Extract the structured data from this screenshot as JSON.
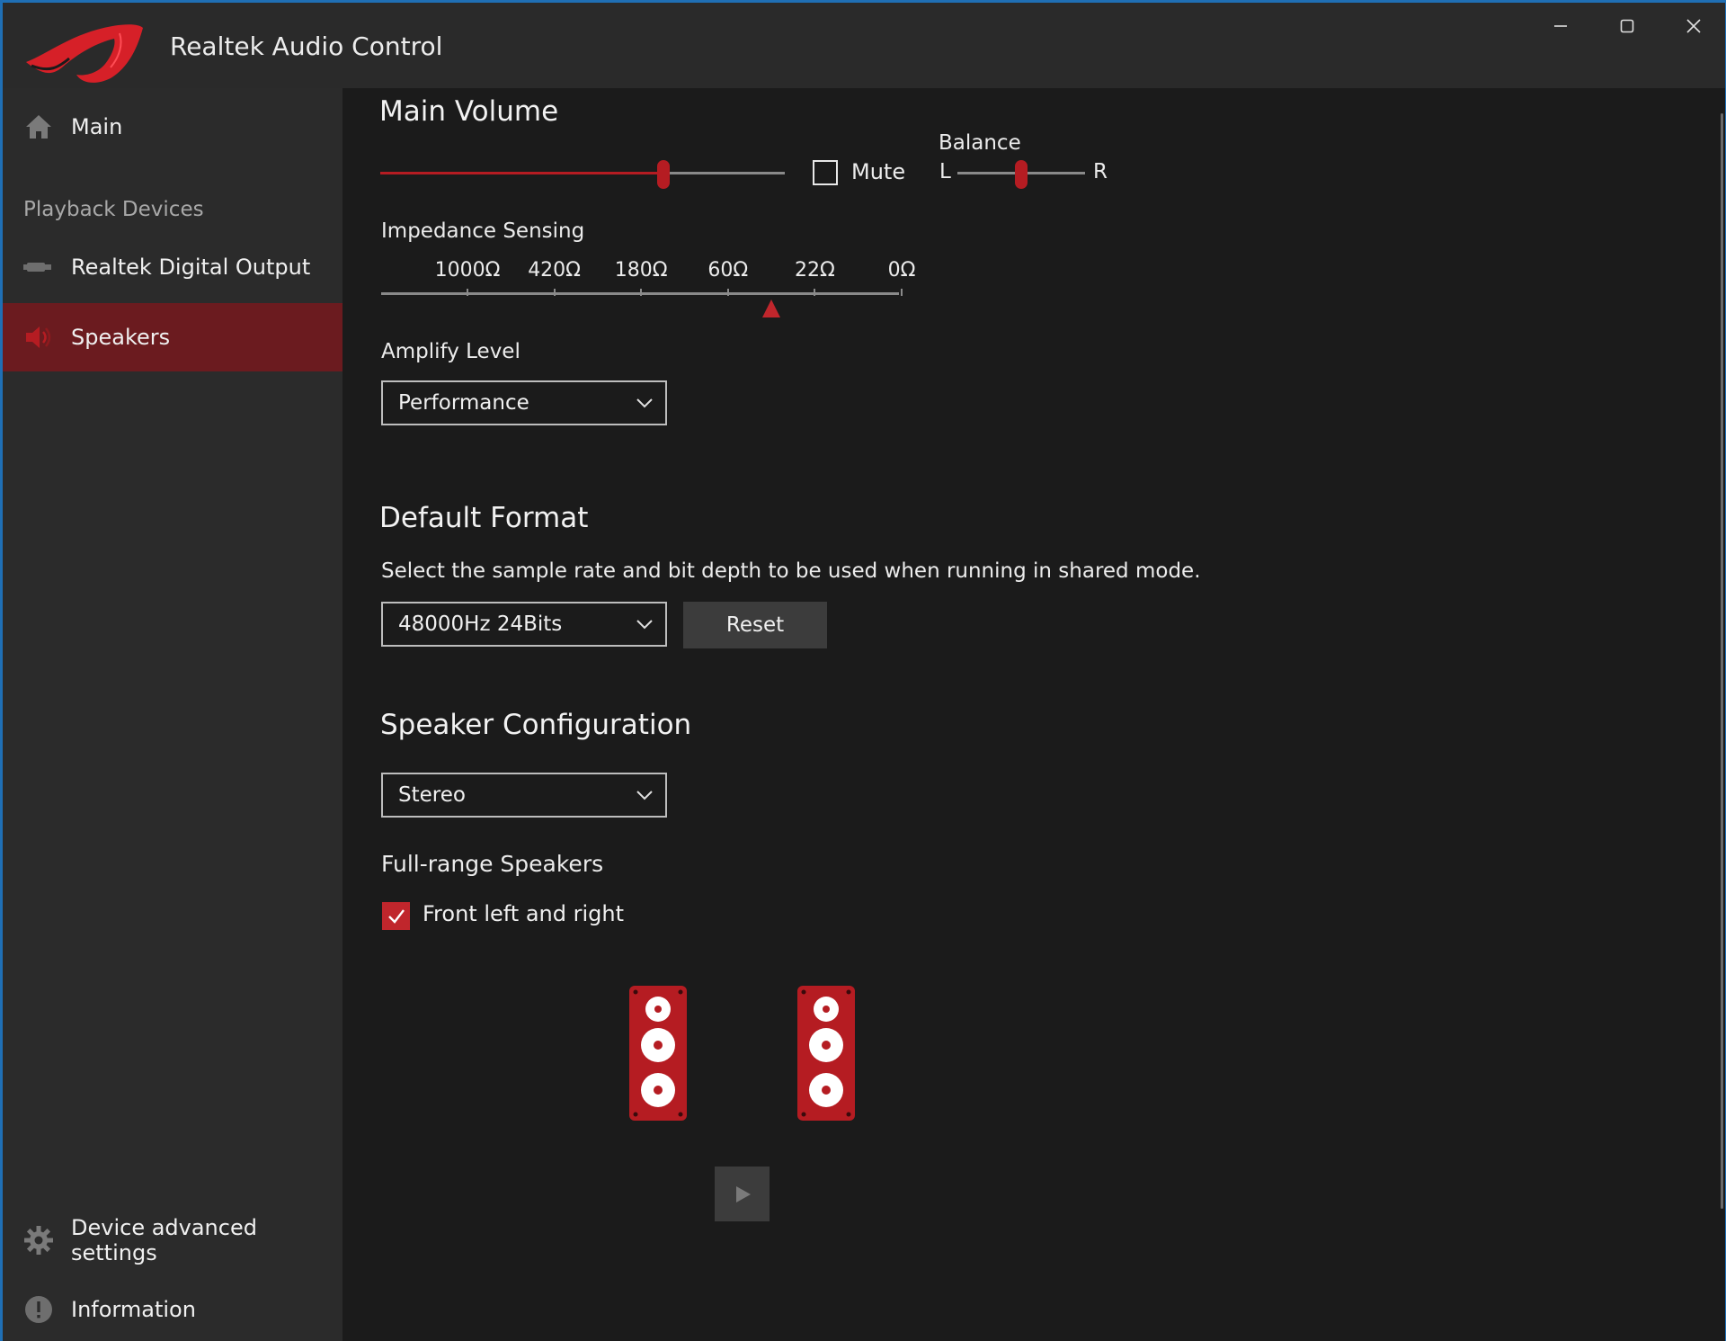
{
  "window": {
    "title": "Realtek Audio Control",
    "controls": [
      "minimize",
      "maximize",
      "close"
    ]
  },
  "sidebar": {
    "main_label": "Main",
    "section_label": "Playback Devices",
    "items": [
      {
        "label": "Realtek Digital Output",
        "icon": "digital-output-icon"
      },
      {
        "label": "Speakers",
        "icon": "speaker-icon",
        "selected": true
      }
    ],
    "advanced_label": "Device advanced settings",
    "info_label": "Information"
  },
  "main_volume": {
    "heading": "Main Volume",
    "value_fraction": 0.7,
    "mute_label": "Mute",
    "muted": false,
    "balance_label": "Balance",
    "balance_left": "L",
    "balance_right": "R",
    "balance_fraction": 0.5
  },
  "impedance": {
    "label": "Impedance Sensing",
    "ticks": [
      "1000Ω",
      "420Ω",
      "180Ω",
      "60Ω",
      "22Ω",
      "0Ω"
    ],
    "marker_between": [
      3,
      4
    ]
  },
  "amplify": {
    "label": "Amplify Level",
    "selected": "Performance"
  },
  "default_format": {
    "heading": "Default Format",
    "description": "Select the sample rate and bit depth to be used when running in shared mode.",
    "selected": "48000Hz 24Bits",
    "reset_label": "Reset"
  },
  "speaker_config": {
    "heading": "Speaker Configuration",
    "selected": "Stereo",
    "fullrange_label": "Full-range Speakers",
    "fullrange_option": "Front left and right",
    "fullrange_checked": true
  },
  "colors": {
    "accent": "#b51c22",
    "sidebar_selected": "#6b1b1f",
    "background": "#1b1b1b",
    "sidebar": "#2b2b2b"
  }
}
